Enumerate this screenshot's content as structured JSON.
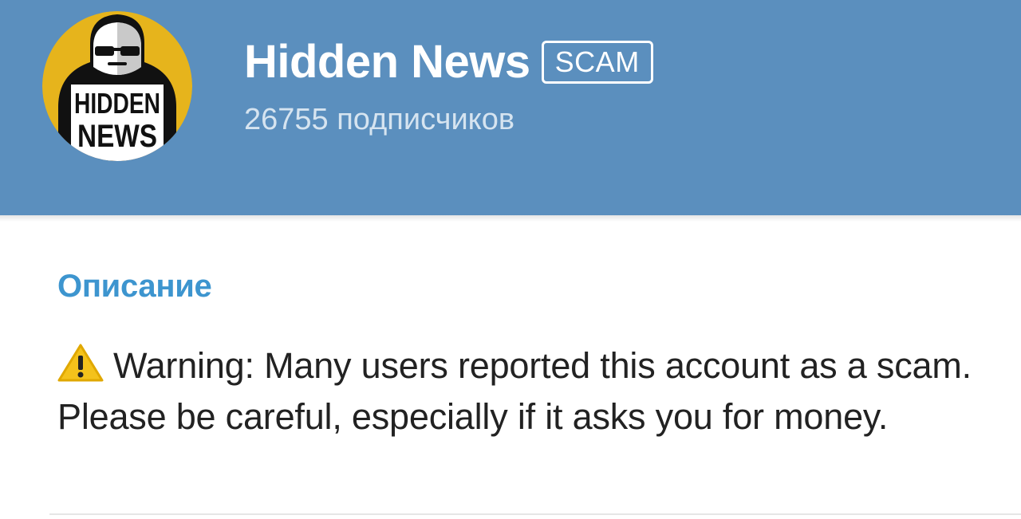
{
  "header": {
    "channel_name": "Hidden News",
    "badge": "SCAM",
    "subscribers": "26755 подписчиков",
    "background_color": "#5b8fbe"
  },
  "avatar": {
    "icon": "hidden-news-logo",
    "lettering_top": "HIDDEN",
    "lettering_bottom": "NEWS",
    "colors": [
      "#e6b41c",
      "#111111",
      "#ffffff",
      "#c9c9c9"
    ]
  },
  "info": {
    "section_title": "Описание",
    "description_icon": "warning-icon",
    "description": "Warning: Many users reported this account as a scam. Please be careful, especially if it asks you for money.",
    "accent_color": "#3d95cf"
  }
}
